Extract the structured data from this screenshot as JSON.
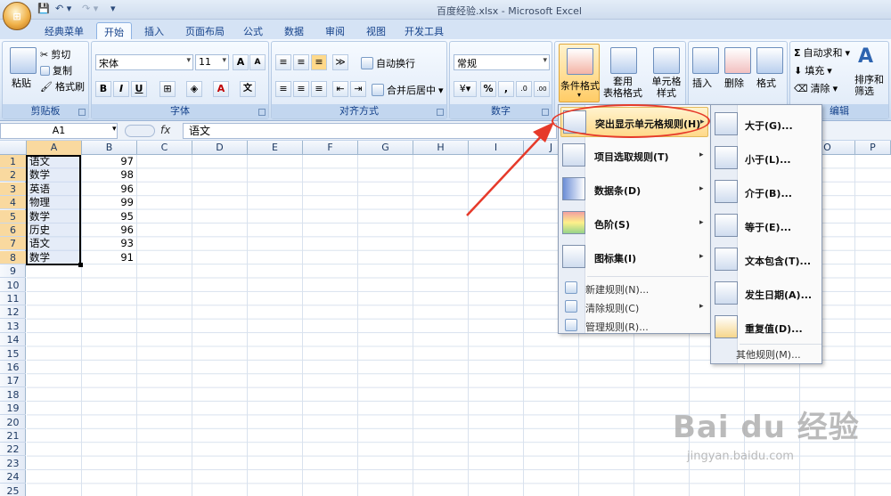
{
  "window": {
    "title": "百度经验.xlsx - Microsoft Excel"
  },
  "tabs": [
    "经典菜单",
    "开始",
    "插入",
    "页面布局",
    "公式",
    "数据",
    "审阅",
    "视图",
    "开发工具"
  ],
  "ribbon": {
    "clipboard": {
      "title": "剪贴板",
      "paste": "粘贴",
      "cut": "剪切",
      "copy": "复制",
      "format_painter": "格式刷"
    },
    "font": {
      "title": "字体",
      "font_name": "宋体",
      "font_size": "11",
      "bold": "B",
      "italic": "I",
      "underline": "U",
      "grow": "A",
      "shrink": "A",
      "font_color": "A",
      "phonetic": "文"
    },
    "alignment": {
      "title": "对齐方式",
      "wrap_text": "自动换行",
      "merge_center": "合并后居中"
    },
    "number": {
      "title": "数字",
      "format": "常规",
      "percent": "%",
      "comma": ",",
      "inc_dec": ".0",
      "dec_dec": ".00"
    },
    "styles": {
      "conditional": "条件格式",
      "as_table": "套用\n表格格式",
      "cell_styles": "单元格\n样式"
    },
    "cells": {
      "insert": "插入",
      "delete": "删除",
      "format": "格式"
    },
    "editing": {
      "title": "编辑",
      "autosum": "自动求和",
      "fill": "填充",
      "clear": "清除",
      "sort": "排序和\n筛选"
    }
  },
  "formula_bar": {
    "name_box": "A1",
    "fx": "fx",
    "content": "语文"
  },
  "columns": [
    "A",
    "B",
    "C",
    "D",
    "E",
    "F",
    "G",
    "H",
    "I",
    "J",
    "K",
    "L",
    "M",
    "N",
    "O",
    "P"
  ],
  "rows": [
    "1",
    "2",
    "3",
    "4",
    "5",
    "6",
    "7",
    "8",
    "9",
    "10",
    "11",
    "12",
    "13",
    "14",
    "15",
    "16",
    "17",
    "18",
    "19",
    "20",
    "21",
    "22",
    "23",
    "24",
    "25"
  ],
  "cells": [
    {
      "a": "语文",
      "b": "97"
    },
    {
      "a": "数学",
      "b": "98"
    },
    {
      "a": "英语",
      "b": "96"
    },
    {
      "a": "物理",
      "b": "99"
    },
    {
      "a": "数学",
      "b": "95"
    },
    {
      "a": "历史",
      "b": "96"
    },
    {
      "a": "语文",
      "b": "93"
    },
    {
      "a": "数学",
      "b": "91"
    }
  ],
  "menu": {
    "items": [
      "突出显示单元格规则(H)",
      "项目选取规则(T)",
      "数据条(D)",
      "色阶(S)",
      "图标集(I)"
    ],
    "small_items": [
      "新建规则(N)...",
      "清除规则(C)",
      "管理规则(R)..."
    ]
  },
  "submenu": {
    "items": [
      "大于(G)...",
      "小于(L)...",
      "介于(B)...",
      "等于(E)...",
      "文本包含(T)...",
      "发生日期(A)...",
      "重复值(D)..."
    ],
    "more": "其他规则(M)..."
  },
  "watermark": {
    "brand": "Bai du 经验",
    "url": "jingyan.baidu.com"
  },
  "colors": {
    "annotation": "#e63a2a",
    "highlight": "#ffd98a",
    "ribbon": "#dbe7f6"
  }
}
